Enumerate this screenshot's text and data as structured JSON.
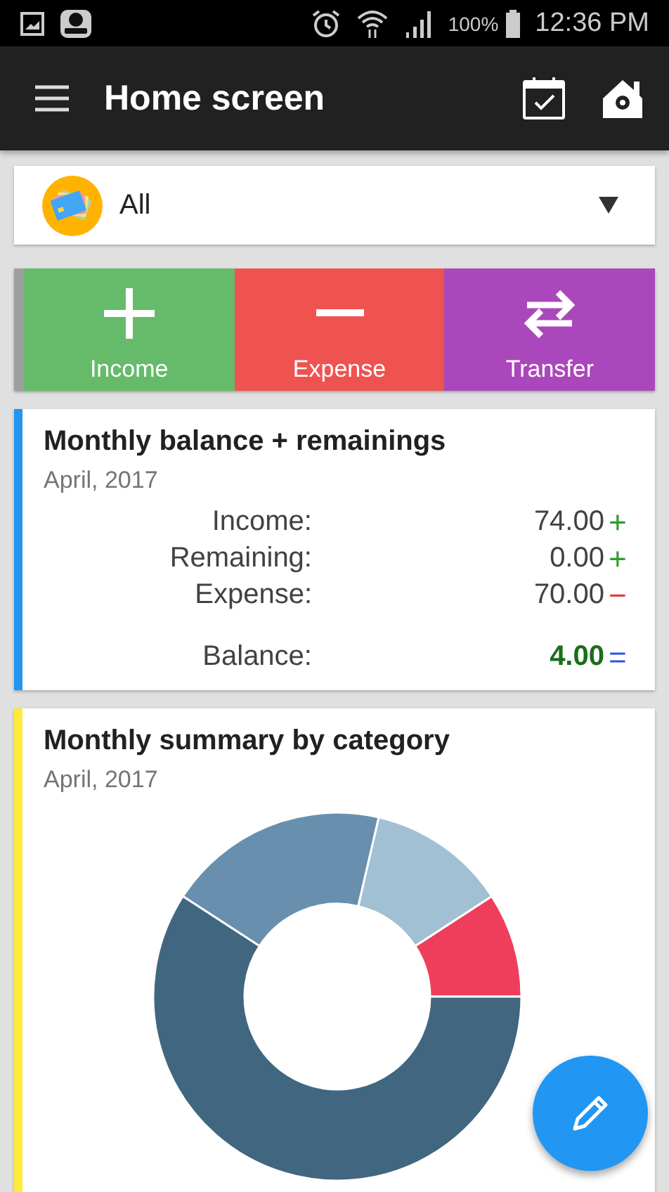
{
  "status_bar": {
    "battery": "100%",
    "time": "12:36 PM"
  },
  "app_bar": {
    "title": "Home screen"
  },
  "account_picker": {
    "value": "All"
  },
  "actions": [
    {
      "kind": "income",
      "label": "Income",
      "color": "#66bb6a"
    },
    {
      "kind": "expense",
      "label": "Expense",
      "color": "#ef5350"
    },
    {
      "kind": "transfer",
      "label": "Transfer",
      "color": "#ab47bc"
    }
  ],
  "balance_card": {
    "title": "Monthly balance + remainings",
    "date": "April, 2017",
    "color": "#2196f3",
    "rows": [
      {
        "kind": "plus",
        "label": "Income:",
        "value": "74.00",
        "sign": "+"
      },
      {
        "kind": "plus",
        "label": "Remaining:",
        "value": "0.00",
        "sign": "+"
      },
      {
        "kind": "minus",
        "label": "Expense:",
        "value": "70.00",
        "sign": "−"
      },
      {
        "kind": "total",
        "label": "Balance:",
        "value": "4.00",
        "sign": "="
      }
    ]
  },
  "category_card": {
    "title": "Monthly summary by category",
    "date": "April, 2017",
    "color": "#ffeb3b"
  }
}
